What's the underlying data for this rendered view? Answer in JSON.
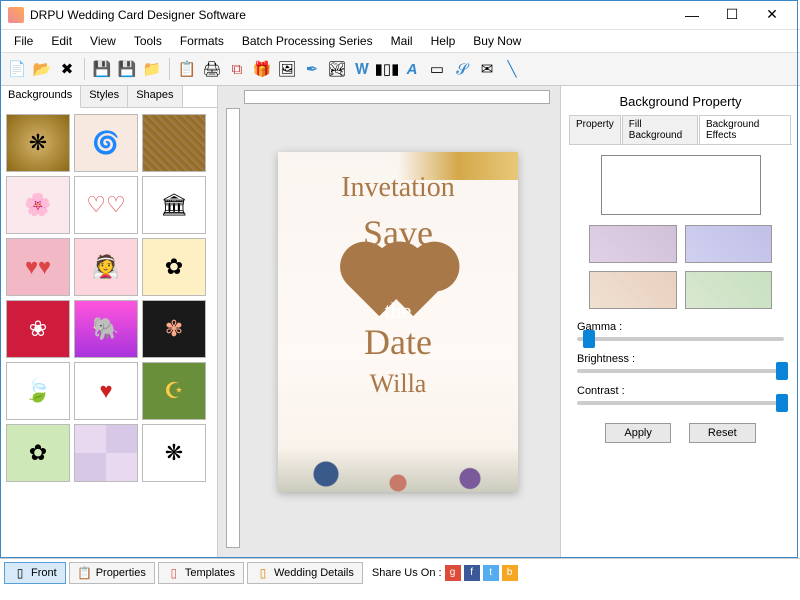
{
  "app": {
    "title": "DRPU Wedding Card Designer Software"
  },
  "menu": [
    "File",
    "Edit",
    "View",
    "Tools",
    "Formats",
    "Batch Processing Series",
    "Mail",
    "Help",
    "Buy Now"
  ],
  "leftpanel": {
    "tabs": [
      "Backgrounds",
      "Styles",
      "Shapes"
    ],
    "active": 0
  },
  "card": {
    "line1": "Invetation",
    "line2": "Save",
    "line3": "the",
    "line4": "Date",
    "name": "Willa"
  },
  "rightpanel": {
    "title": "Background Property",
    "tabs": [
      "Property",
      "Fill Background",
      "Background Effects"
    ],
    "active": 2,
    "sliders": {
      "gamma": {
        "label": "Gamma :",
        "pos": 3
      },
      "brightness": {
        "label": "Brightness :",
        "pos": 96
      },
      "contrast": {
        "label": "Contrast :",
        "pos": 96
      }
    },
    "buttons": {
      "apply": "Apply",
      "reset": "Reset"
    }
  },
  "bottombar": {
    "buttons": [
      "Front",
      "Properties",
      "Templates",
      "Wedding Details"
    ],
    "active": 0,
    "share_label": "Share Us On :"
  }
}
